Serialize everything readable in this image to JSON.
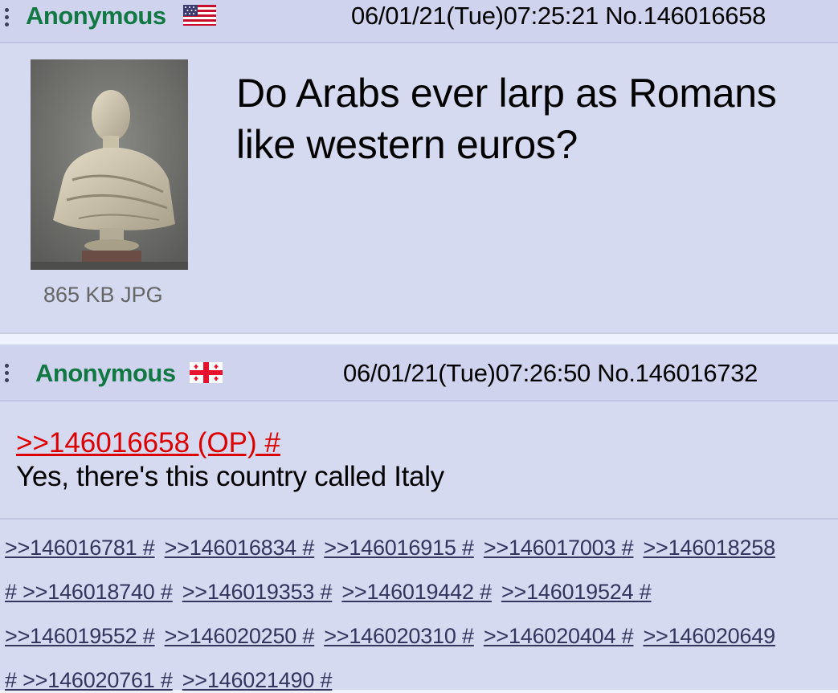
{
  "op_post": {
    "name": "Anonymous",
    "flag_icon": "us-flag-icon",
    "datetime": "06/01/21(Tue)07:25:21",
    "post_no": "No.146016658",
    "file_info": "865 KB JPG",
    "subject": "Do Arabs ever larp as Romans like western euros?"
  },
  "reply_post": {
    "name": "Anonymous",
    "flag_icon": "georgia-flag-icon",
    "datetime": "06/01/21(Tue)07:26:50",
    "post_no": "No.146016732",
    "quote_link": ">>146016658 (OP) #",
    "message": "Yes, there's this country called Italy"
  },
  "backlinks": [
    [
      ">>146016781 #",
      ">>146016834 #",
      ">>146016915 #",
      ">>146017003 #",
      ">>146018258"
    ],
    [
      "# >>146018740 #",
      ">>146019353 #",
      ">>146019442 #",
      ">>146019524 #"
    ],
    [
      ">>146019552 #",
      ">>146020250 #",
      ">>146020310 #",
      ">>146020404 #",
      ">>146020649"
    ],
    [
      "# >>146020761 #",
      ">>146021490 #"
    ]
  ],
  "colors": {
    "post_bg": "#d6daf0",
    "name_green": "#117743",
    "quote_red": "#dd0000",
    "link_blue": "#34345c"
  }
}
